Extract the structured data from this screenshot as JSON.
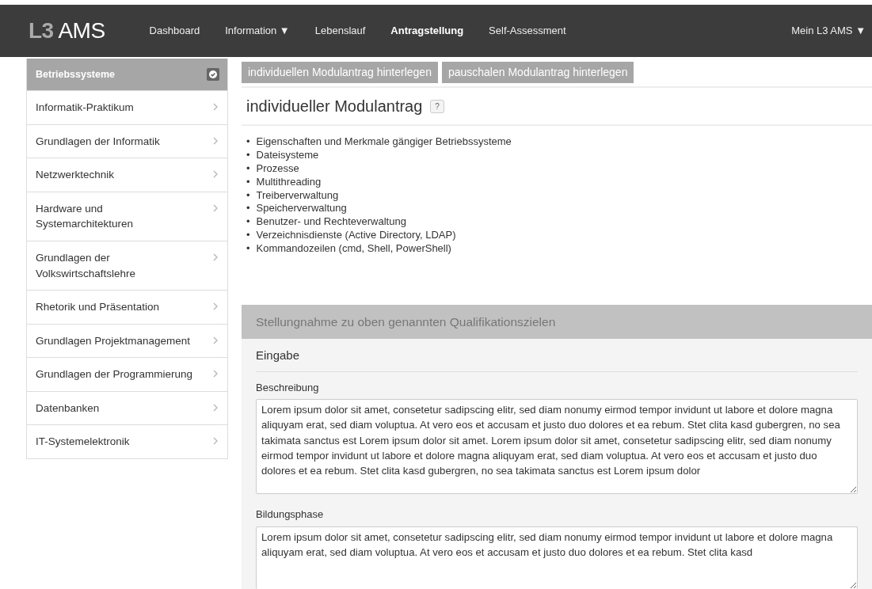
{
  "navbar": {
    "brand_prefix": "L3",
    "brand_name": "AMS",
    "items": [
      {
        "label": "Dashboard",
        "selected": false
      },
      {
        "label": "Information",
        "caret": "▼",
        "selected": false
      },
      {
        "label": "Lebenslauf",
        "selected": false
      },
      {
        "label": "Antragstellung",
        "selected": true
      },
      {
        "label": "Self-Assessment",
        "selected": false
      }
    ],
    "user_menu": {
      "label": "Mein L3 AMS",
      "caret": "▼"
    }
  },
  "sidebar": {
    "items": [
      {
        "label": "Betriebssysteme",
        "selected": true
      },
      {
        "label": "Informatik-Praktikum",
        "selected": false
      },
      {
        "label": "Grundlagen der Informatik",
        "selected": false
      },
      {
        "label": "Netzwerktechnik",
        "selected": false
      },
      {
        "label": "Hardware und Systemarchitekturen",
        "selected": false
      },
      {
        "label": "Grundlagen der Volkswirtschaftslehre",
        "selected": false
      },
      {
        "label": "Rhetorik und Präsentation",
        "selected": false
      },
      {
        "label": "Grundlagen Projektmanagement",
        "selected": false
      },
      {
        "label": "Grundlagen der Programmierung",
        "selected": false
      },
      {
        "label": "Datenbanken",
        "selected": false
      },
      {
        "label": "IT-Systemelektronik",
        "selected": false
      }
    ]
  },
  "action_buttons": [
    "individuellen Modulantrag hinterlegen",
    "pauschalen Modulantrag hinterlegen"
  ],
  "heading": {
    "title": "individueller Modulantrag",
    "help": "?"
  },
  "qualification_goals": [
    {
      "marker": "•",
      "text": "Eigenschaften und Merkmale gängiger Betriebssysteme"
    },
    {
      "marker": "•",
      "text": "Dateisysteme"
    },
    {
      "marker": "•",
      "text": "Prozesse"
    },
    {
      "marker": "•",
      "text": "Multithreading"
    },
    {
      "marker": "•",
      "text": "Treiberverwaltung"
    },
    {
      "marker": "•",
      "text": "Speicherverwaltung"
    },
    {
      "marker": "•",
      "text": "Benutzer- und Rechteverwaltung"
    },
    {
      "marker": "•",
      "text": "Verzeichnisdienste (Active Directory, LDAP)"
    },
    {
      "marker": "•",
      "text": "Kommandozeilen (cmd, Shell, PowerShell)"
    }
  ],
  "statement_panel": {
    "title": "Stellungnahme zu oben genannten Qualifikationszielen",
    "section": "Eingabe",
    "fields": [
      {
        "label": "Beschreibung",
        "value": "Lorem ipsum dolor sit amet, consetetur sadipscing elitr, sed diam nonumy eirmod tempor invidunt ut labore et dolore magna aliquyam erat, sed diam voluptua. At vero eos et accusam et justo duo dolores et ea rebum. Stet clita kasd gubergren, no sea takimata sanctus est Lorem ipsum dolor sit amet. Lorem ipsum dolor sit amet, consetetur sadipscing elitr, sed diam nonumy eirmod tempor invidunt ut labore et dolore magna aliquyam erat, sed diam voluptua. At vero eos et accusam et justo duo dolores et ea rebum. Stet clita kasd gubergren, no sea takimata sanctus est Lorem ipsum dolor"
      },
      {
        "label": "Bildungsphase",
        "value": "Lorem ipsum dolor sit amet, consetetur sadipscing elitr, sed diam nonumy eirmod tempor invidunt ut labore et dolore magna aliquyam erat, sed diam voluptua. At vero eos et accusam et justo duo dolores et ea rebum. Stet clita kasd"
      }
    ]
  }
}
